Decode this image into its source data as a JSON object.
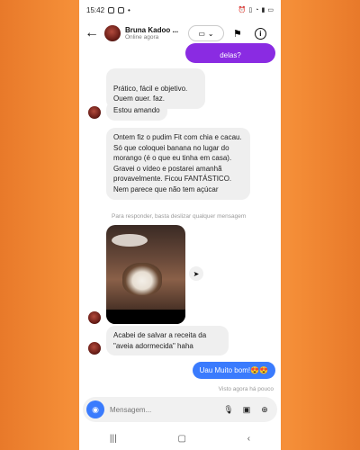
{
  "status": {
    "time": "15:42"
  },
  "header": {
    "back_icon": "arrow-left-icon",
    "contact_name": "Bruna Kadoo ...",
    "contact_status": "Online agora"
  },
  "messages": {
    "sent_partial": "delas?",
    "r1": "Prático, fácil e objetivo.\nQuem quer, faz.",
    "r2": "Estou amando",
    "r3": "Ontem fiz o pudim Fit com chia e cacau. Só que coloquei banana no lugar do morango (é o que eu tinha em casa). Gravei o vídeo e postarei amanhã provavelmente. Ficou FANTÁSTICO. Nem parece que não tem açúcar",
    "reply_hint": "Para responder, basta deslizar qualquer mensagem",
    "r4": "Acabei de salvar a receita da \"aveia adormecida\" haha",
    "sent_last": "Uau Muito bom!😍😍",
    "seen": "Visto agora há pouco"
  },
  "composer": {
    "placeholder": "Mensagem..."
  },
  "colors": {
    "sent_purple": "#8a2be2",
    "sent_blue": "#3a7bfd",
    "received_bg": "#efefef",
    "background_orange": "#f58f38"
  }
}
